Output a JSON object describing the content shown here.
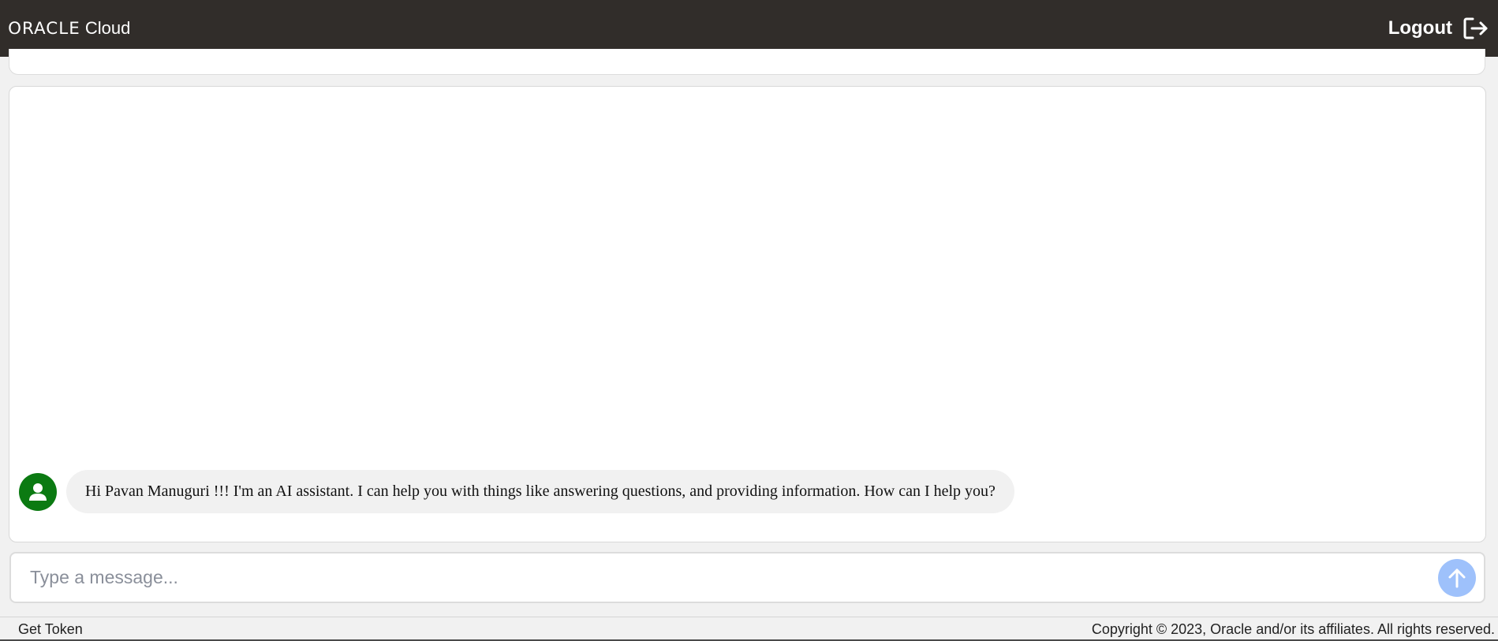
{
  "header": {
    "brand_oracle": "ORACLE",
    "brand_cloud": "Cloud",
    "logout_label": "Logout",
    "logout_icon": "logout-arrow-icon",
    "background_color": "#312d2a"
  },
  "chat": {
    "messages": [
      {
        "sender": "assistant",
        "avatar_icon": "user-avatar-icon",
        "avatar_color": "#0b7a12",
        "text": "Hi Pavan Manuguri !!! I'm an AI assistant. I can help you with things like answering questions, and providing information. How can I help you?"
      }
    ]
  },
  "composer": {
    "placeholder": "Type a message...",
    "value": "",
    "send_icon": "arrow-up-icon",
    "send_color": "#9ec1fb"
  },
  "footer": {
    "get_token_label": "Get Token",
    "copyright": "Copyright © 2023, Oracle and/or its affiliates. All rights reserved."
  }
}
